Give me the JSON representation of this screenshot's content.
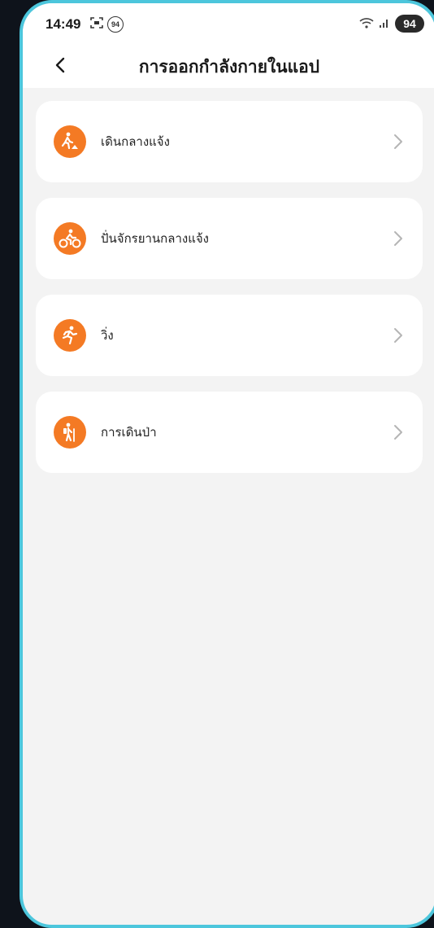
{
  "status_bar": {
    "time": "14:49",
    "notification_badge": "94",
    "battery_level": "94",
    "icons": [
      "screenshot-icon",
      "notification-count-icon",
      "wifi-icon",
      "signal-icon",
      "battery-icon"
    ]
  },
  "header": {
    "title": "การออกกำลังกายในแอป",
    "back_icon": "chevron-left-icon"
  },
  "colors": {
    "accent": "#f47a24",
    "frame": "#4cc6dc",
    "background": "#f3f3f3",
    "card": "#ffffff"
  },
  "activities": [
    {
      "label": "เดินกลางแจ้ง",
      "icon": "outdoor-walk-icon"
    },
    {
      "label": "ปั่นจักรยานกลางแจ้ง",
      "icon": "outdoor-cycling-icon"
    },
    {
      "label": "วิ่ง",
      "icon": "running-icon"
    },
    {
      "label": "การเดินป่า",
      "icon": "hiking-icon"
    }
  ]
}
